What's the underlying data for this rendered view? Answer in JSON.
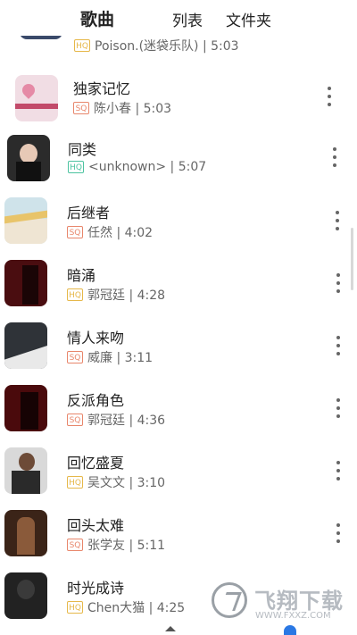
{
  "tabs": {
    "songs": "歌曲",
    "lists": "列表",
    "folders": "文件夹"
  },
  "songs": [
    {
      "title": "",
      "quality": "",
      "meta": "Poison.(迷袋乐队) | 5:03",
      "quality_color": "#e6b84a"
    },
    {
      "title": "独家记忆",
      "quality": "SQ",
      "meta": "陈小春 | 5:03",
      "quality_color": "#e8866b"
    },
    {
      "title": "同类",
      "quality": "HQ",
      "meta": "<unknown> | 5:07",
      "quality_color": "#4cc3a0"
    },
    {
      "title": "后继者",
      "quality": "SQ",
      "meta": "任然 | 4:02",
      "quality_color": "#e8866b"
    },
    {
      "title": "暗涌",
      "quality": "HQ",
      "meta": "郭冠廷 | 4:28",
      "quality_color": "#e6b84a"
    },
    {
      "title": "情人来吻",
      "quality": "SQ",
      "meta": "威廉 | 3:11",
      "quality_color": "#e8866b"
    },
    {
      "title": "反派角色",
      "quality": "SQ",
      "meta": "郭冠廷 | 4:36",
      "quality_color": "#e8866b"
    },
    {
      "title": "回忆盛夏",
      "quality": "HQ",
      "meta": "吴文文 | 3:10",
      "quality_color": "#e6b84a"
    },
    {
      "title": "回头太难",
      "quality": "SQ",
      "meta": "张学友 | 5:11",
      "quality_color": "#e8866b"
    },
    {
      "title": "时光成诗",
      "quality": "HQ",
      "meta": "Chen大猫 | 4:25",
      "quality_color": "#e6b84a"
    }
  ],
  "watermark": {
    "brand": "飞翔下载",
    "url": "WWW.FXXZ.COM"
  },
  "icons": {
    "more": "more-vertical-icon",
    "home": "home-icon",
    "me": "profile-icon"
  }
}
